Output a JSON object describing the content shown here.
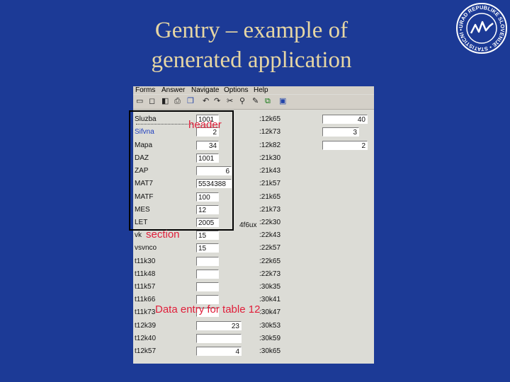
{
  "title": {
    "line1": "Gentry – example of",
    "line2": "generated application"
  },
  "logo": {
    "ring_text": "URAD REPUBLIKE SLOVENIJE • STATISTICNI •"
  },
  "menu": [
    "Forms",
    "Answer",
    "Navigate",
    "Options",
    "Help"
  ],
  "toolbar_icons": [
    "new-icon",
    "open-icon",
    "prev-icon",
    "print-icon",
    "copy-icon",
    "undo-icon",
    "redo-icon",
    "cut-icon",
    "attach-icon",
    "edit-icon",
    "duplicate-icon",
    "chart-icon"
  ],
  "rows": [
    {
      "label": "Sluzba",
      "value": "1001",
      "code": ":12k65"
    },
    {
      "label": "Sifvna",
      "value": "2",
      "code": ":12k73"
    },
    {
      "label": "Mapa",
      "value": "34",
      "code": ":12k82"
    },
    {
      "label": "DAZ",
      "value": "1001",
      "code": ":21k30"
    },
    {
      "label": "ZAP",
      "value": "6",
      "code": ":21k43"
    },
    {
      "label": "MAT7",
      "value": "5534388",
      "code": ":21k57"
    },
    {
      "label": "MATF",
      "value": "100",
      "code": ":21k65"
    },
    {
      "label": "MES",
      "value": "12",
      "code": ":21k73"
    },
    {
      "label": "LET",
      "value": "2005",
      "code": ":22k30"
    },
    {
      "label": "vk",
      "value": "15",
      "code": ":22k43"
    },
    {
      "label": "vsvnco",
      "value": "15",
      "code": ":22k57"
    },
    {
      "label": "t11k30",
      "value": "",
      "code": ":22k65"
    },
    {
      "label": "t11k48",
      "value": "",
      "code": ":22k73"
    },
    {
      "label": "t11k57",
      "value": "",
      "code": ":30k35"
    },
    {
      "label": "t11k66",
      "value": "",
      "code": ":30k41"
    },
    {
      "label": "t11k73",
      "value": "",
      "code": ":30k47"
    },
    {
      "label": "t12k39",
      "value": "23",
      "code": ":30k53"
    },
    {
      "label": "t12k40",
      "value": "",
      "code": ":30k59"
    },
    {
      "label": "t12k57",
      "value": "4",
      "code": ":30k65"
    }
  ],
  "mid_label": "4f6ux",
  "right_fields": [
    "40",
    "3",
    "2"
  ],
  "annotations": {
    "header": "header",
    "section": "section",
    "data_entry": "Data entry for table 12"
  },
  "colors": {
    "background": "#1c3a96",
    "title": "#e6d6a4",
    "annotation": "#e01e3a"
  }
}
